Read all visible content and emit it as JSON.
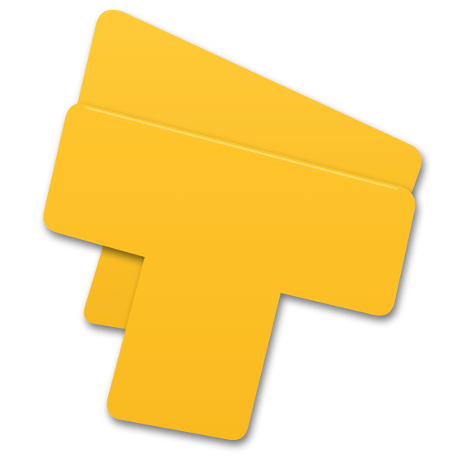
{
  "logo": {
    "icon": "yellow-t-logo-icon",
    "colors": {
      "fill": "#FFC125",
      "fill_back": "#FBBC22",
      "highlight": "#FFE27A",
      "shadow": "#C98A00",
      "background": "#FFFFFF"
    }
  }
}
